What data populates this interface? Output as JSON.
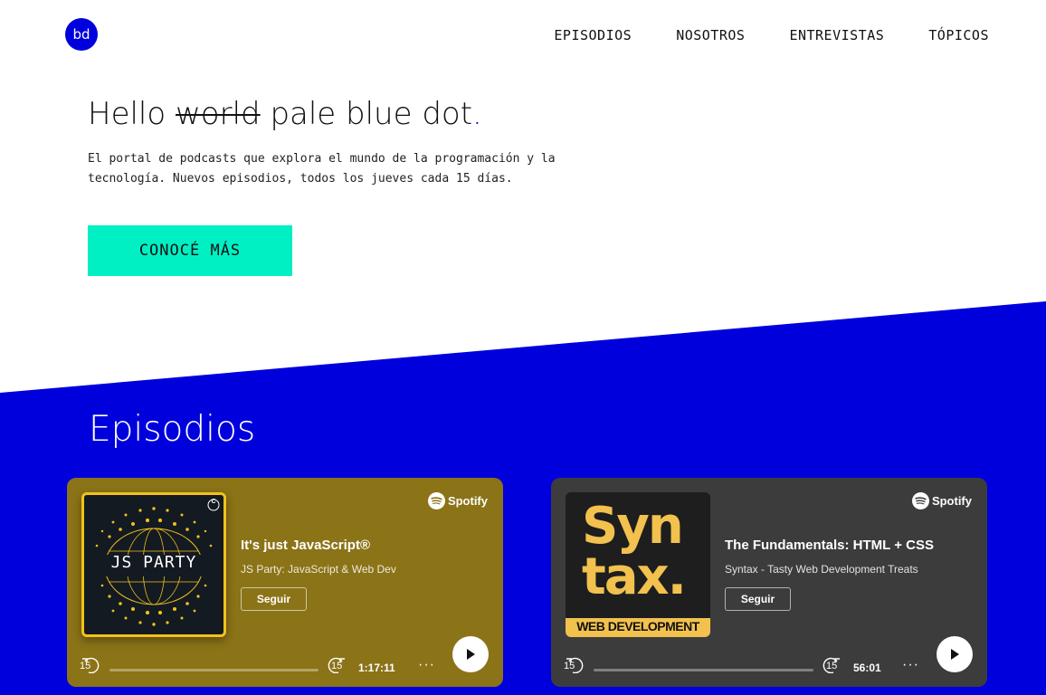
{
  "header": {
    "logo_text": "bd",
    "nav": [
      "EPISODIOS",
      "NOSOTROS",
      "ENTREVISTAS",
      "TÓPICOS"
    ]
  },
  "hero": {
    "title_start": "Hello",
    "title_struck": "world",
    "title_end": "pale blue dot",
    "title_dot": ".",
    "description": "El portal de podcasts que explora el mundo de la programación y la tecnología. Nuevos episodios, todos los jueves cada 15 días.",
    "cta_label": "CONOCÉ MÁS"
  },
  "episodes_section": {
    "title": "Episodios",
    "cards": [
      {
        "brand": "Spotify",
        "episode_title": "It's just JavaScript®",
        "show": "JS Party: JavaScript & Web Dev",
        "follow_label": "Seguir",
        "art_text": "JS PARTY",
        "art_badge": "C",
        "skip_back": "15",
        "skip_forward": "15",
        "duration": "1:17:11",
        "more": "···",
        "progress": 0,
        "background": "#8b7317"
      },
      {
        "brand": "Spotify",
        "episode_title": "The Fundamentals: HTML + CSS",
        "show": "Syntax - Tasty Web Development Treats",
        "follow_label": "Seguir",
        "art_text_line1": "Syn",
        "art_text_line2": "tax.",
        "art_banner": "WEB DEVELOPMENT",
        "skip_back": "15",
        "skip_forward": "15",
        "duration": "56:01",
        "more": "···",
        "progress": 0,
        "background": "#3c3c3c"
      }
    ]
  },
  "colors": {
    "brand_blue": "#0000dd",
    "cta_green": "#00f0c4",
    "art_yellow": "#f2c21b"
  }
}
